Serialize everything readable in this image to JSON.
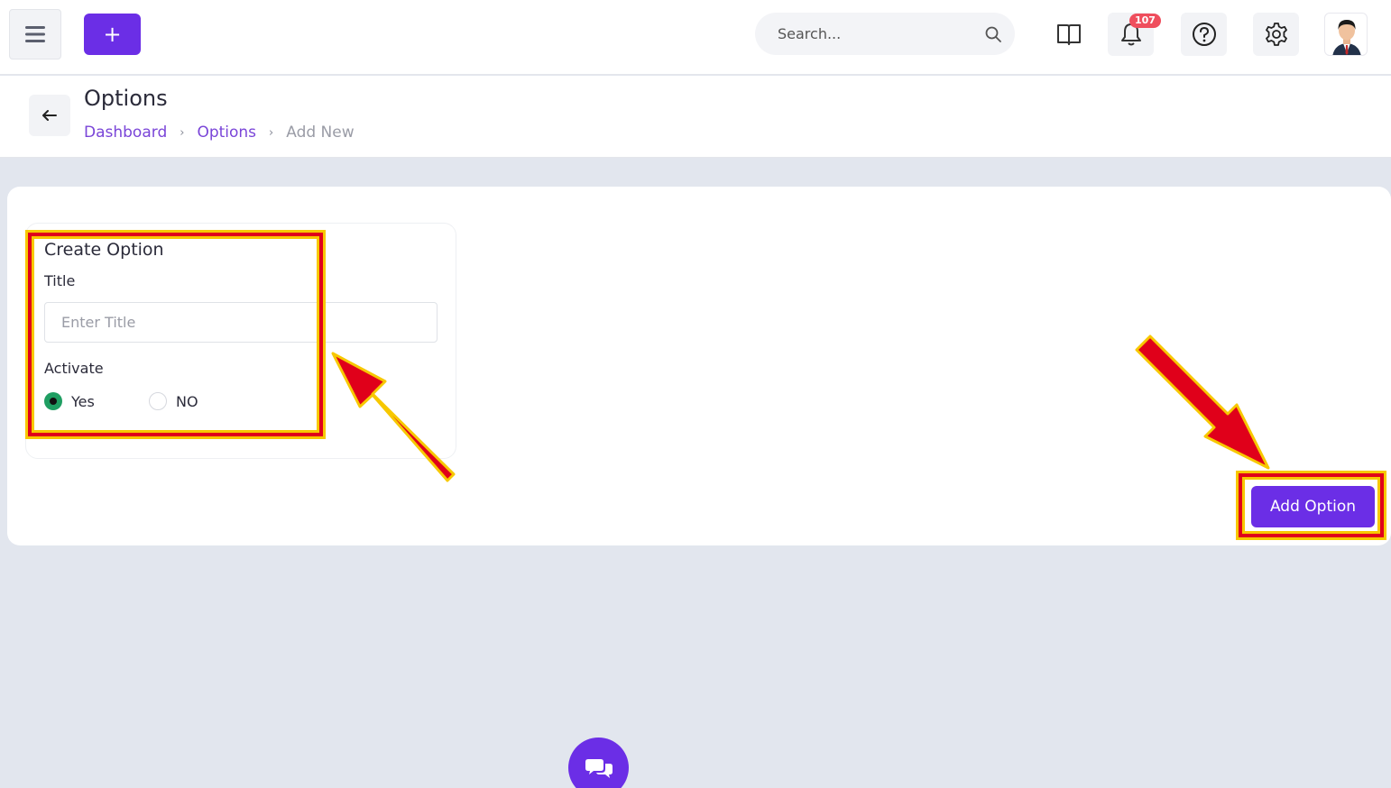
{
  "topbar": {
    "add_label": "+",
    "search_placeholder": "Search...",
    "notification_count": "107"
  },
  "page": {
    "title": "Options",
    "breadcrumb": [
      {
        "label": "Dashboard"
      },
      {
        "label": "Options"
      },
      {
        "label": "Add New"
      }
    ]
  },
  "form": {
    "heading": "Create Option",
    "title_label": "Title",
    "title_placeholder": "Enter Title",
    "title_value": "",
    "activate_label": "Activate",
    "options": [
      {
        "label": "Yes",
        "selected": true
      },
      {
        "label": "NO",
        "selected": false
      }
    ],
    "submit_label": "Add Option"
  },
  "colors": {
    "accent": "#6b2ee6",
    "badge": "#ef4e5d",
    "radio_on": "#1f9e62",
    "annotation_red": "#e0001a",
    "annotation_yellow": "#f7c800"
  },
  "icons": [
    "hamburger-icon",
    "plus-icon",
    "search-icon",
    "book-icon",
    "bell-icon",
    "help-icon",
    "gear-icon",
    "avatar-image",
    "back-arrow-icon",
    "chat-icon"
  ]
}
